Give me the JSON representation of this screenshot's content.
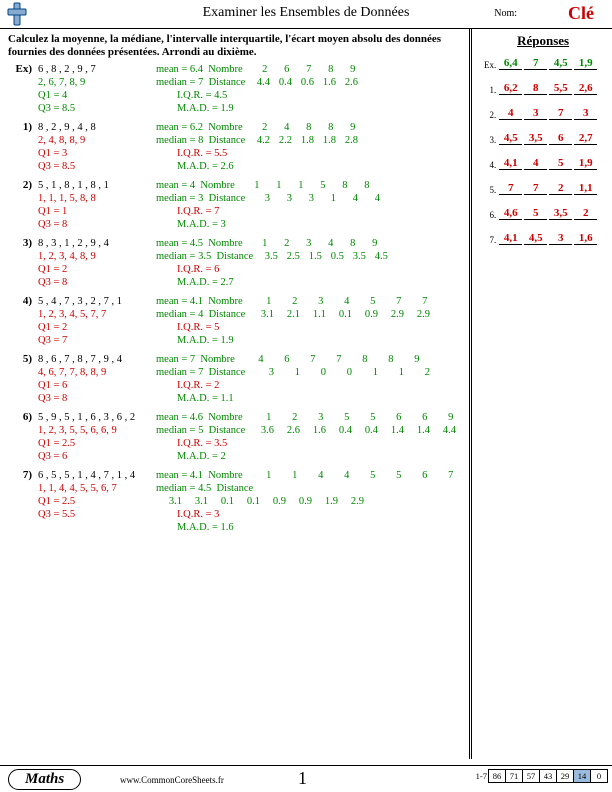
{
  "header": {
    "title": "Examiner les Ensembles de Données",
    "name_label": "Nom:",
    "key": "Clé"
  },
  "instructions": "Calculez la moyenne, la médiane, l'intervalle interquartile, l'écart moyen absolu des données fournies des données présentées. Arrondi au dixième.",
  "labels": {
    "mean": "mean =",
    "median": "median =",
    "nombre": "Nombre",
    "distance": "Distance",
    "iqr": "I.Q.R. =",
    "mad": "M.A.D. =",
    "q1": "Q1 =",
    "q3": "Q3 ="
  },
  "problems": [
    {
      "num": "Ex)",
      "ex": true,
      "data": "6 , 8 , 2 , 9 , 7",
      "sorted": "2, 6, 7, 8, 9",
      "q1": "4",
      "q3": "8.5",
      "mean": "6.4",
      "median": "7",
      "nombre": [
        "2",
        "6",
        "7",
        "8",
        "9"
      ],
      "distance": [
        "4.4",
        "0.4",
        "0.6",
        "1.6",
        "2.6"
      ],
      "iqr": "4.5",
      "mad": "1.9"
    },
    {
      "num": "1)",
      "data": "8 , 2 , 9 , 4 , 8",
      "sorted": "2, 4, 8, 8, 9",
      "q1": "3",
      "q3": "8.5",
      "mean": "6.2",
      "median": "8",
      "nombre": [
        "2",
        "4",
        "8",
        "8",
        "9"
      ],
      "distance": [
        "4.2",
        "2.2",
        "1.8",
        "1.8",
        "2.8"
      ],
      "iqr": "5.5",
      "mad": "2.6"
    },
    {
      "num": "2)",
      "data": "5 , 1 , 8 , 1 , 8 , 1",
      "sorted": "1, 1, 1, 5, 8, 8",
      "q1": "1",
      "q3": "8",
      "mean": "4",
      "median": "3",
      "nombre": [
        "1",
        "1",
        "1",
        "5",
        "8",
        "8"
      ],
      "distance": [
        "3",
        "3",
        "3",
        "1",
        "4",
        "4"
      ],
      "iqr": "7",
      "mad": "3"
    },
    {
      "num": "3)",
      "data": "8 , 3 , 1 , 2 , 9 , 4",
      "sorted": "1, 2, 3, 4, 8, 9",
      "q1": "2",
      "q3": "8",
      "mean": "4.5",
      "median": "3.5",
      "nombre": [
        "1",
        "2",
        "3",
        "4",
        "8",
        "9"
      ],
      "distance": [
        "3.5",
        "2.5",
        "1.5",
        "0.5",
        "3.5",
        "4.5"
      ],
      "iqr": "6",
      "mad": "2.7"
    },
    {
      "num": "4)",
      "data": "5 , 4 , 7 , 3 , 2 , 7 , 1",
      "sorted": "1, 2, 3, 4, 5, 7, 7",
      "q1": "2",
      "q3": "7",
      "mean": "4.1",
      "median": "4",
      "nombre": [
        "1",
        "2",
        "3",
        "4",
        "5",
        "7",
        "7"
      ],
      "distance": [
        "3.1",
        "2.1",
        "1.1",
        "0.1",
        "0.9",
        "2.9",
        "2.9"
      ],
      "iqr": "5",
      "mad": "1.9"
    },
    {
      "num": "5)",
      "data": "8 , 6 , 7 , 8 , 7 , 9 , 4",
      "sorted": "4, 6, 7, 7, 8, 8, 9",
      "q1": "6",
      "q3": "8",
      "mean": "7",
      "median": "7",
      "nombre": [
        "4",
        "6",
        "7",
        "7",
        "8",
        "8",
        "9"
      ],
      "distance": [
        "3",
        "1",
        "0",
        "0",
        "1",
        "1",
        "2"
      ],
      "iqr": "2",
      "mad": "1.1"
    },
    {
      "num": "6)",
      "data": "5 , 9 , 5 , 1 , 6 , 3 , 6 , 2",
      "sorted": "1, 2, 3, 5, 5, 6, 6, 9",
      "q1": "2.5",
      "q3": "6",
      "mean": "4.6",
      "median": "5",
      "nombre": [
        "1",
        "2",
        "3",
        "5",
        "5",
        "6",
        "6",
        "9"
      ],
      "distance": [
        "3.6",
        "2.6",
        "1.6",
        "0.4",
        "0.4",
        "1.4",
        "1.4",
        "4.4"
      ],
      "iqr": "3.5",
      "mad": "2"
    },
    {
      "num": "7)",
      "data": "6 , 5 , 5 , 1 , 4 , 7 , 1 , 4",
      "sorted": "1, 1, 4, 4, 5, 5, 6, 7",
      "q1": "2.5",
      "q3": "5.5",
      "mean": "4.1",
      "median": "4.5",
      "nombre": [
        "1",
        "1",
        "4",
        "4",
        "5",
        "5",
        "6",
        "7"
      ],
      "distance": [
        "3.1",
        "3.1",
        "0.1",
        "0.1",
        "0.9",
        "0.9",
        "1.9",
        "2.9"
      ],
      "iqr": "3",
      "mad": "1.6"
    }
  ],
  "answers": {
    "title": "Réponses",
    "rows": [
      {
        "num": "Ex.",
        "ex": true,
        "vals": [
          "6,4",
          "7",
          "4,5",
          "1,9"
        ]
      },
      {
        "num": "1.",
        "vals": [
          "6,2",
          "8",
          "5,5",
          "2,6"
        ]
      },
      {
        "num": "2.",
        "vals": [
          "4",
          "3",
          "7",
          "3"
        ]
      },
      {
        "num": "3.",
        "vals": [
          "4,5",
          "3,5",
          "6",
          "2,7"
        ]
      },
      {
        "num": "4.",
        "vals": [
          "4,1",
          "4",
          "5",
          "1,9"
        ]
      },
      {
        "num": "5.",
        "vals": [
          "7",
          "7",
          "2",
          "1,1"
        ]
      },
      {
        "num": "6.",
        "vals": [
          "4,6",
          "5",
          "3,5",
          "2"
        ]
      },
      {
        "num": "7.",
        "vals": [
          "4,1",
          "4,5",
          "3",
          "1,6"
        ]
      }
    ]
  },
  "footer": {
    "subject": "Maths",
    "url": "www.CommonCoreSheets.fr",
    "page": "1",
    "scale_label": "1-7",
    "scale": [
      "86",
      "71",
      "57",
      "43",
      "29",
      "14",
      "0"
    ],
    "highlight": 5
  }
}
